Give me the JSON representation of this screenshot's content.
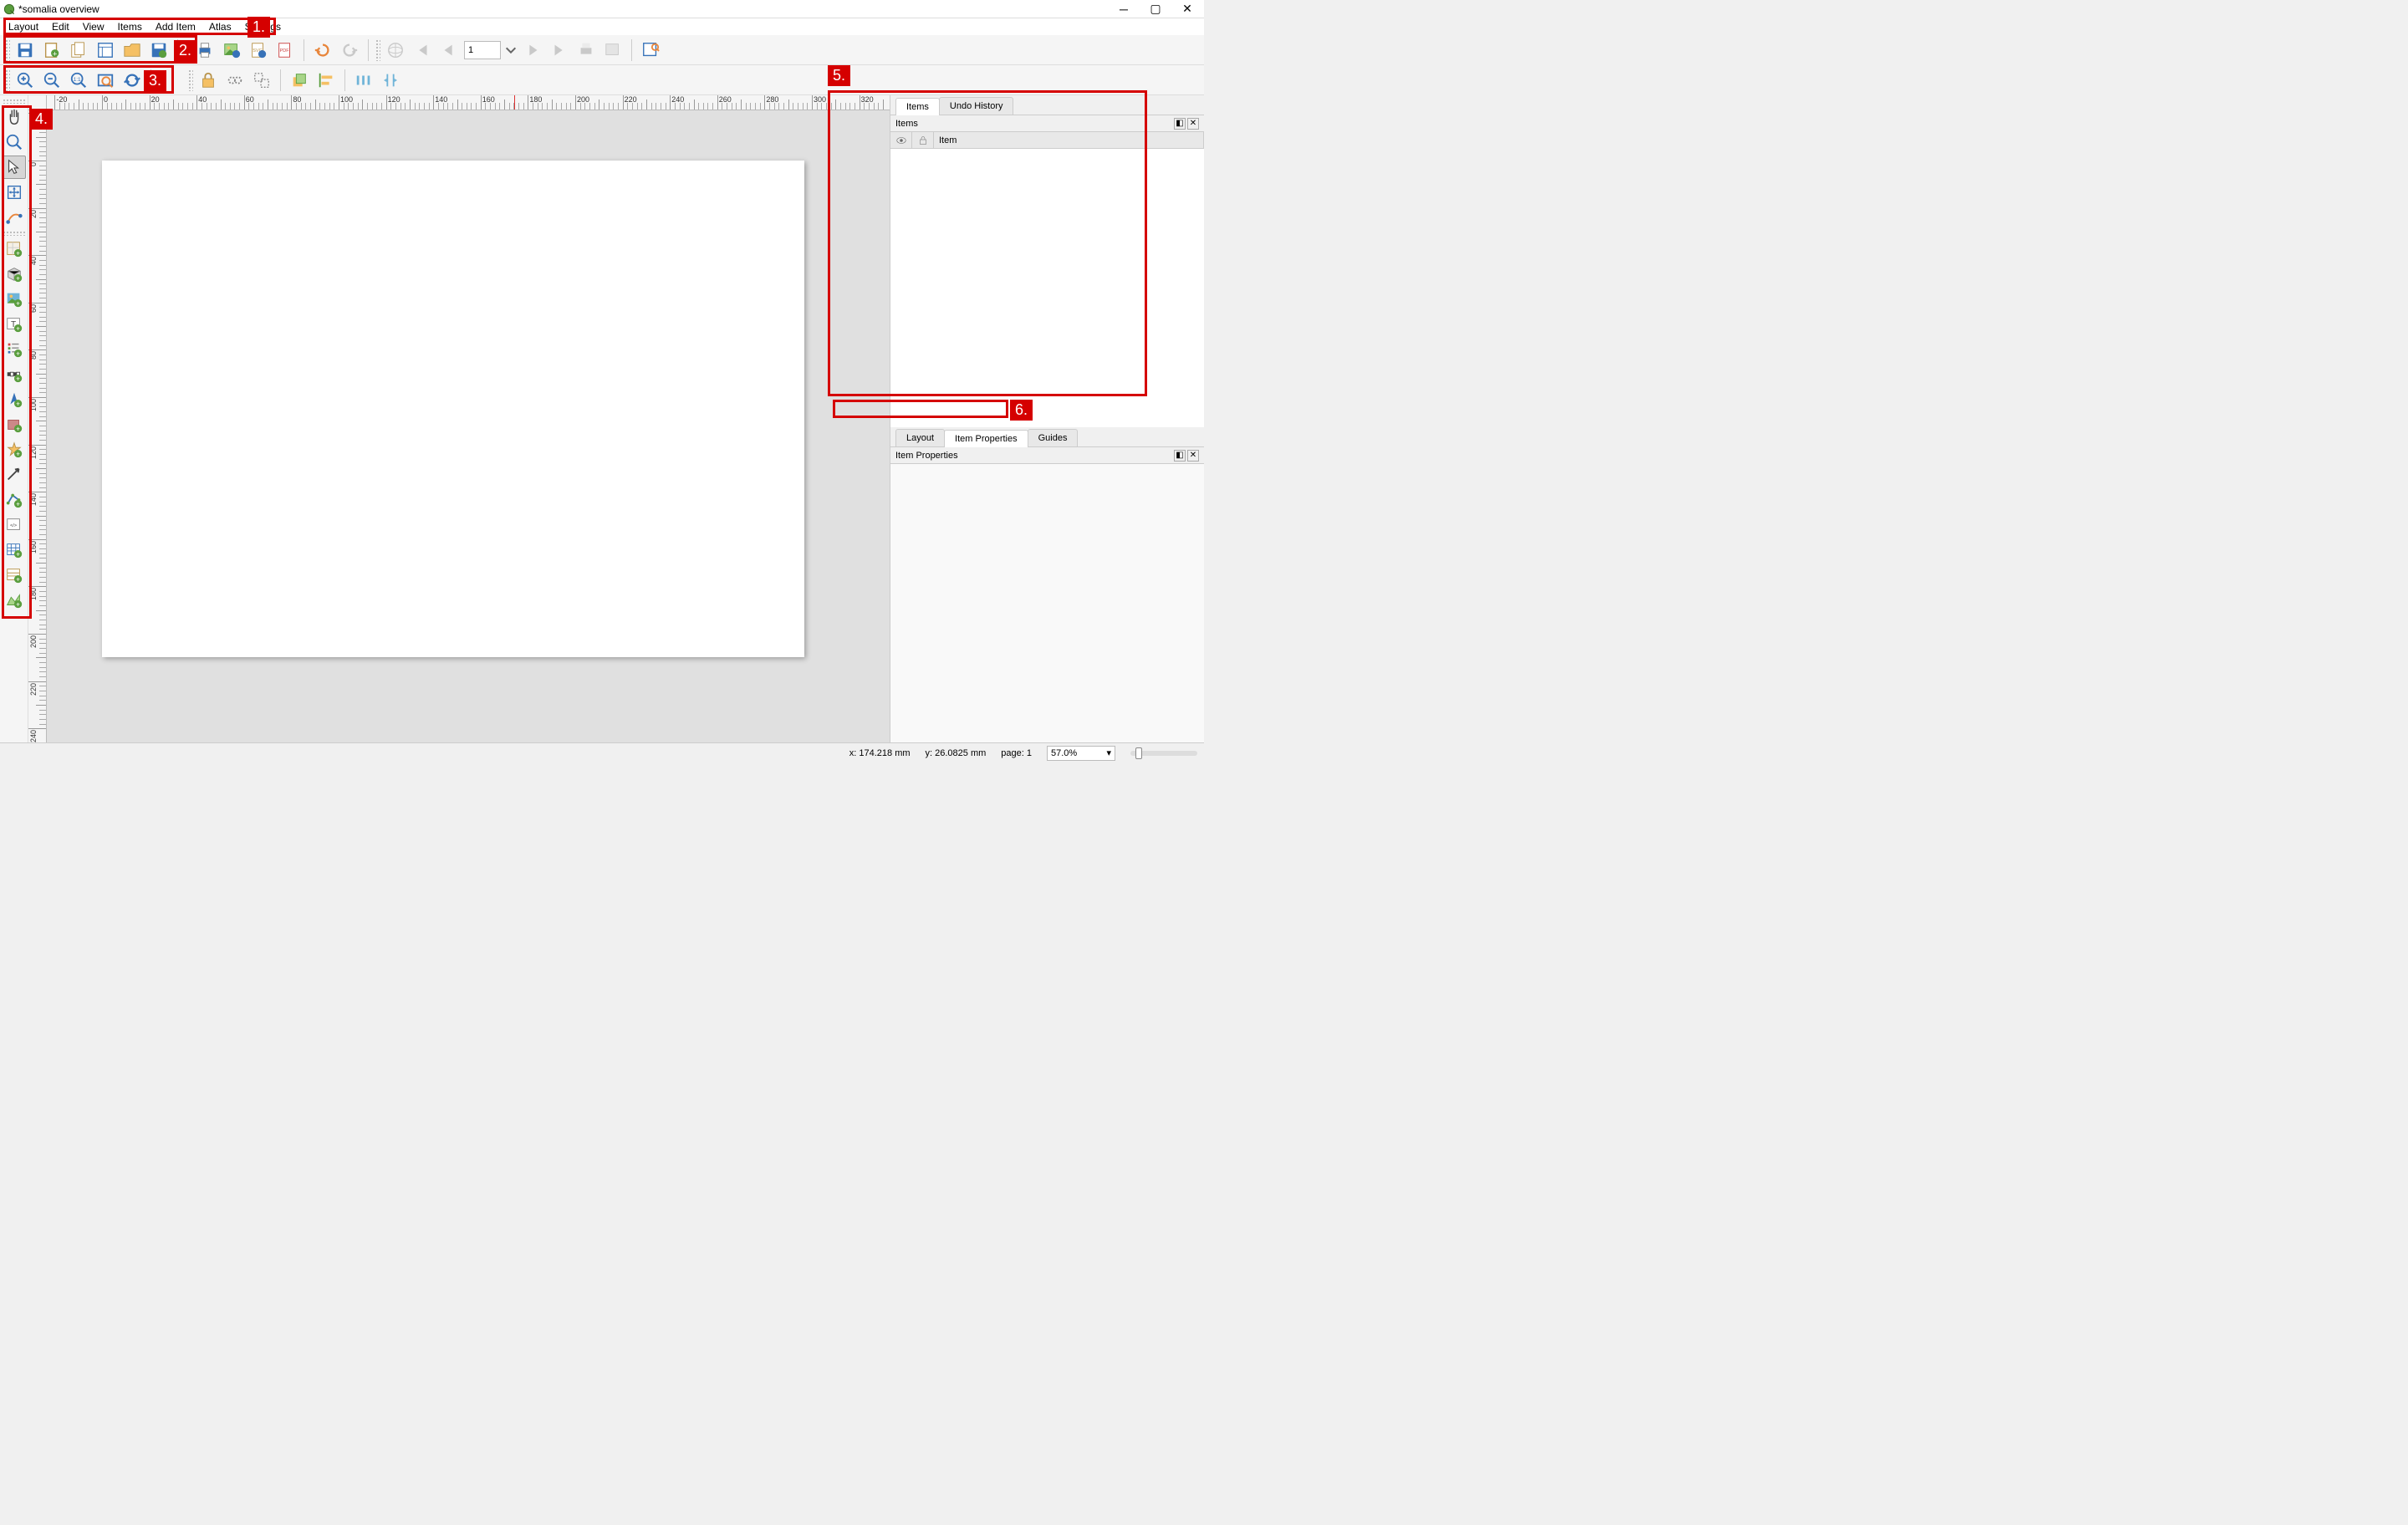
{
  "window": {
    "title": "*somalia overview"
  },
  "menu": {
    "items": [
      "Layout",
      "Edit",
      "View",
      "Items",
      "Add Item",
      "Atlas",
      "Settings"
    ]
  },
  "toolbar1": {
    "page_value": "1"
  },
  "ruler": {
    "h_marks": [
      0,
      20,
      40,
      60,
      80,
      100,
      120,
      140,
      160,
      180,
      200,
      220,
      240,
      260,
      280,
      300
    ],
    "v_marks": [
      0,
      20,
      40,
      60,
      80,
      100,
      120,
      140,
      160,
      180,
      200,
      220
    ]
  },
  "right": {
    "items_tab": "Items",
    "undo_tab": "Undo History",
    "items_panel_title": "Items",
    "item_col": "Item",
    "layout_tab": "Layout",
    "item_props_tab": "Item Properties",
    "guides_tab": "Guides",
    "item_props_title": "Item Properties"
  },
  "status": {
    "x": "x: 174.218 mm",
    "y": "y: 26.0825 mm",
    "page": "page: 1",
    "zoom": "57.0%"
  },
  "annotations": {
    "a1": "1.",
    "a2": "2.",
    "a3": "3.",
    "a4": "4.",
    "a5": "5.",
    "a6": "6."
  }
}
